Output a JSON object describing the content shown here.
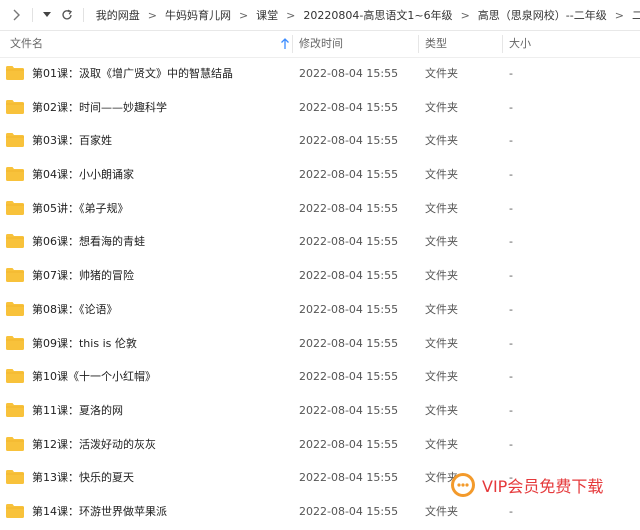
{
  "breadcrumb": [
    "我的网盘",
    "牛妈妈育儿网",
    "课堂",
    "20220804-高思语文1~6年级",
    "高思（思泉网校）--二年级",
    "二年级上册语文"
  ],
  "columns": {
    "name": "文件名",
    "modified": "修改时间",
    "type": "类型",
    "size": "大小"
  },
  "files": [
    {
      "name": "第01课：汲取《增广贤文》中的智慧结晶",
      "modified": "2022-08-04 15:55",
      "type": "文件夹",
      "size": "-"
    },
    {
      "name": "第02课：时间——妙趣科学",
      "modified": "2022-08-04 15:55",
      "type": "文件夹",
      "size": "-"
    },
    {
      "name": "第03课：百家姓",
      "modified": "2022-08-04 15:55",
      "type": "文件夹",
      "size": "-"
    },
    {
      "name": "第04课：小小朗诵家",
      "modified": "2022-08-04 15:55",
      "type": "文件夹",
      "size": "-"
    },
    {
      "name": "第05讲：《弟子规》",
      "modified": "2022-08-04 15:55",
      "type": "文件夹",
      "size": "-"
    },
    {
      "name": "第06课：想看海的青蛙",
      "modified": "2022-08-04 15:55",
      "type": "文件夹",
      "size": "-"
    },
    {
      "name": "第07课：帅猪的冒险",
      "modified": "2022-08-04 15:55",
      "type": "文件夹",
      "size": "-"
    },
    {
      "name": "第08课：《论语》",
      "modified": "2022-08-04 15:55",
      "type": "文件夹",
      "size": "-"
    },
    {
      "name": "第09课：this is 伦敦",
      "modified": "2022-08-04 15:55",
      "type": "文件夹",
      "size": "-"
    },
    {
      "name": "第10课《十一个小红帽》",
      "modified": "2022-08-04 15:55",
      "type": "文件夹",
      "size": "-"
    },
    {
      "name": "第11课：夏洛的网",
      "modified": "2022-08-04 15:55",
      "type": "文件夹",
      "size": "-"
    },
    {
      "name": "第12课：活泼好动的灰灰",
      "modified": "2022-08-04 15:55",
      "type": "文件夹",
      "size": "-"
    },
    {
      "name": "第13课：快乐的夏天",
      "modified": "2022-08-04 15:55",
      "type": "文件夹",
      "size": "-"
    },
    {
      "name": "第14课：环游世界做苹果派",
      "modified": "2022-08-04 15:55",
      "type": "文件夹",
      "size": "-"
    }
  ],
  "watermark": {
    "text": "VIP会员免费下载"
  },
  "colors": {
    "folder": "#f8c23b",
    "accent": "#3b8cff",
    "watermark": "#e5393b"
  },
  "icons": {
    "back": "chevron-right-icon",
    "dropdown": "caret-down-icon",
    "refresh": "refresh-icon",
    "sort": "arrow-up-icon",
    "folder": "folder-icon"
  }
}
